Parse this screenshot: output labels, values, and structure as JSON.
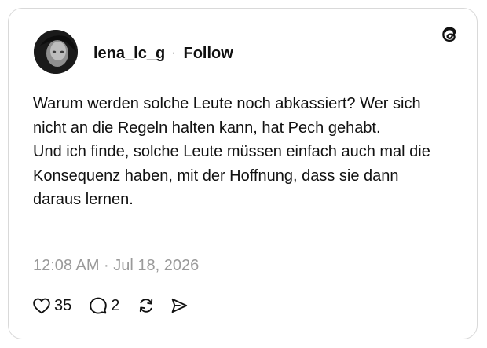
{
  "post": {
    "username": "lena_lc_g",
    "separator": "·",
    "follow_label": "Follow",
    "text": "Warum werden solche Leute noch abkassiert? Wer sich nicht an die Regeln halten kann, hat Pech gehabt.\nUnd ich finde, solche Leute müssen einfach auch mal die Konsequenz haben, mit der Hoffnung, dass sie dann daraus lernen.",
    "timestamp": "12:08 AM · Jul 18, 2026"
  },
  "actions": {
    "likes": "35",
    "replies": "2"
  },
  "icons": {
    "brand": "threads-logo-icon",
    "like": "heart-icon",
    "reply": "comment-bubble-icon",
    "repost": "repost-icon",
    "share": "send-icon"
  }
}
